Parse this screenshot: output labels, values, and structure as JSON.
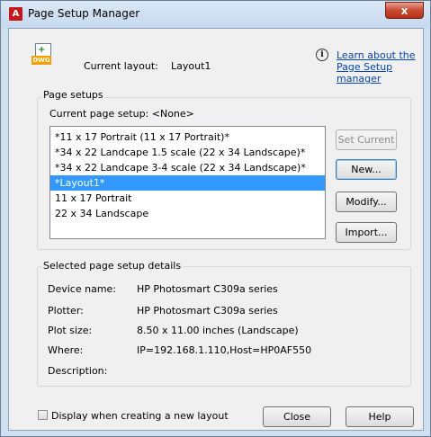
{
  "window": {
    "title": "Page Setup Manager",
    "close_glyph": "x"
  },
  "header": {
    "icon_text": "DWG",
    "current_layout_label": "Current layout:",
    "current_layout_value": "Layout1",
    "info_glyph": "i",
    "learn_link": "Learn about the Page Setup manager"
  },
  "page_setups": {
    "legend": "Page setups",
    "current_setup_label": "Current page setup:  <None>",
    "items": [
      "*11 x 17 Portrait (11 x 17 Portrait)*",
      "*34 x 22 Landcape 1.5 scale (22 x 34 Landscape)*",
      "*34 x 22 Landcape 3-4 scale (22 x 34 Landscape)*",
      "*Layout1*",
      "11 x 17 Portrait",
      "22 x 34 Landscape"
    ],
    "selected_index": 3,
    "buttons": {
      "set_current": "Set Current",
      "new": "New...",
      "modify": "Modify...",
      "import": "Import..."
    }
  },
  "details": {
    "legend": "Selected page setup details",
    "device_name_label": "Device name:",
    "device_name_value": "HP Photosmart C309a series",
    "plotter_label": "Plotter:",
    "plotter_value": "HP Photosmart C309a series",
    "plot_size_label": "Plot size:",
    "plot_size_value": "8.50 x 11.00 inches (Landscape)",
    "where_label": "Where:",
    "where_value": "IP=192.168.1.110,Host=HP0AF550",
    "description_label": "Description:"
  },
  "footer": {
    "checkbox_label": "Display when creating a new layout",
    "close": "Close",
    "help": "Help"
  }
}
